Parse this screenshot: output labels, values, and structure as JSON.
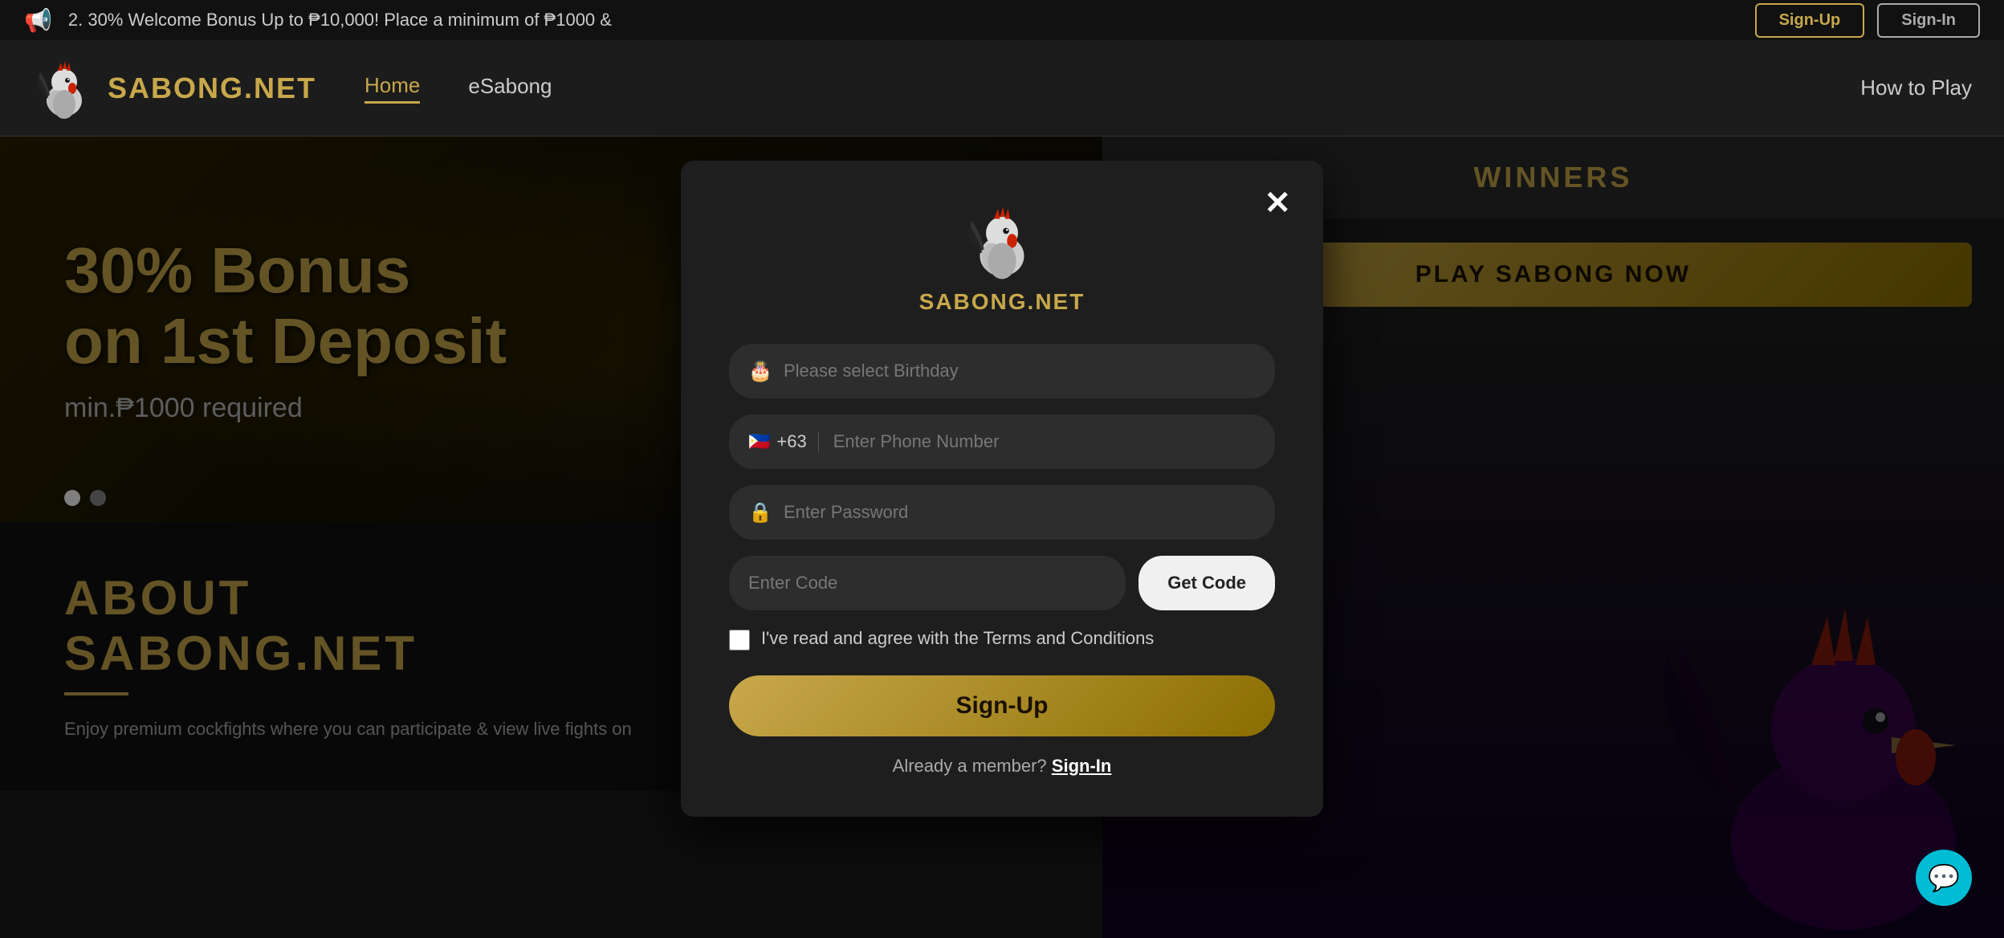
{
  "announcement": {
    "text": "2. 30% Welcome Bonus Up to ₱10,000! Place a minimum of ₱1000 &",
    "megaphone_icon": "📢"
  },
  "header": {
    "logo_text": "SABONG.NET",
    "nav_links": [
      {
        "label": "Home",
        "active": true
      },
      {
        "label": "eSabong",
        "active": false
      },
      {
        "label": "How to Play",
        "active": false
      }
    ],
    "btn_signup": "Sign-Up",
    "btn_signin": "Sign-In"
  },
  "banner": {
    "line1": "30% Bonus",
    "line2": "on 1st Deposit",
    "line3": "min.₱1000 required"
  },
  "about": {
    "title_line1": "ABOUT",
    "title_line2": "SABONG.NET",
    "text": "Enjoy premium cockfights where you can participate & view live fights on"
  },
  "right_panel": {
    "winners_label": "WINNERS",
    "play_btn_label": "PLAY SABONG NOW"
  },
  "modal": {
    "logo_text": "SABONG.NET",
    "close_label": "✕",
    "birthday_placeholder": "Please select Birthday",
    "phone_prefix": "+63",
    "phone_flag": "🇵🇭",
    "phone_placeholder": "Enter Phone Number",
    "password_placeholder": "Enter Password",
    "code_placeholder": "Enter Code",
    "get_code_label": "Get Code",
    "terms_text": "I've read and agree with the Terms and Conditions",
    "signup_label": "Sign-Up",
    "already_member": "Already a member?",
    "signin_label": "Sign-In"
  },
  "chat": {
    "icon": "💬"
  }
}
